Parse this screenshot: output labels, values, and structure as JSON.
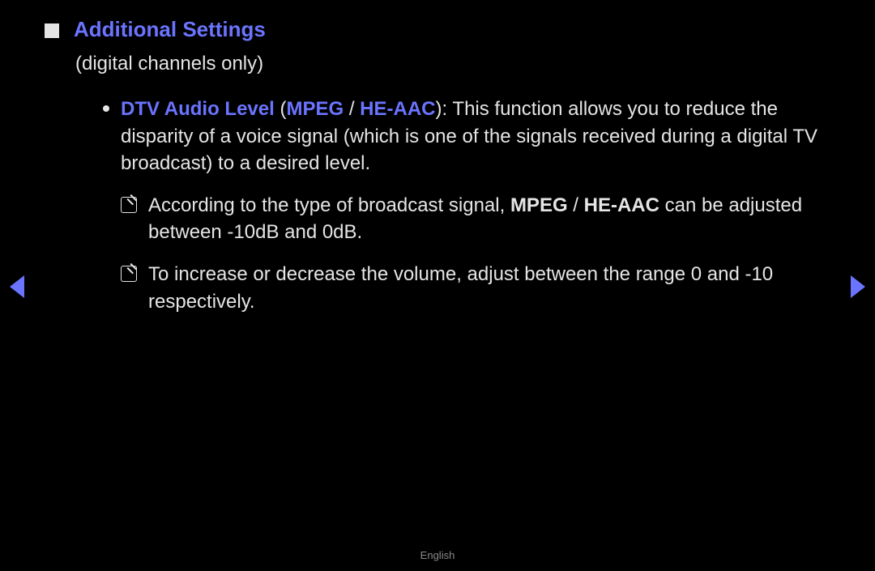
{
  "heading": "Additional Settings",
  "subtext": "(digital channels only)",
  "item": {
    "label": "DTV Audio Level",
    "paren_open": " (",
    "opt1": "MPEG",
    "sep": " / ",
    "opt2": "HE-AAC",
    "paren_close": "): ",
    "desc": "This function allows you to reduce the disparity of a voice signal (which is one of the signals received during a digital TV broadcast) to a desired level."
  },
  "note1": {
    "pre": "According to the type of broadcast signal, ",
    "opt1": "MPEG",
    "sep": " / ",
    "opt2": "HE-AAC",
    "post": " can be adjusted between -10dB and 0dB."
  },
  "note2": "To increase or decrease the volume, adjust between the range 0 and -10 respectively.",
  "footer": "English"
}
